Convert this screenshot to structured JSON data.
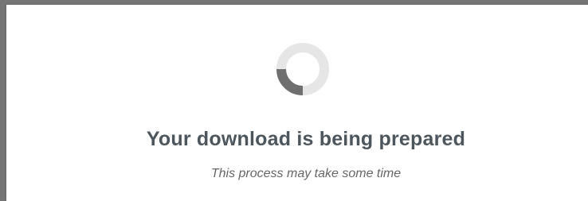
{
  "dialog": {
    "title": "Your download is being prepared",
    "subtitle": "This process may take some time"
  },
  "spinner": {
    "icon": "loading-spinner-icon",
    "track_color": "#e6e6e6",
    "arc_color": "#6f6f6f"
  }
}
